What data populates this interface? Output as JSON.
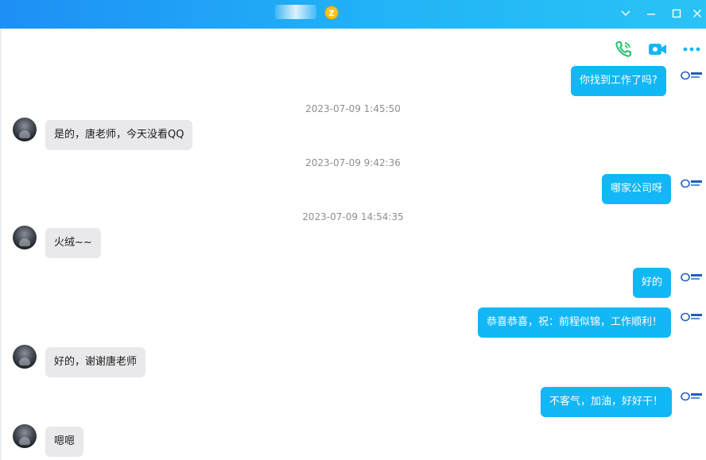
{
  "window": {
    "title_badge_icon": "level-badge-icon",
    "controls": [
      "chevron-down-icon",
      "minimize-icon",
      "maximize-icon",
      "close-icon"
    ]
  },
  "toolbar": {
    "icons": [
      "phone-call-icon",
      "video-call-icon",
      "more-icon"
    ]
  },
  "colors": {
    "titlebar_start": "#1e8ff5",
    "titlebar_end": "#2ac3f5",
    "outgoing_bubble": "#12b7f5",
    "incoming_bubble": "#e9e9eb",
    "phone_icon": "#22c36b",
    "video_icon": "#12b7f5"
  },
  "messages": [
    {
      "type": "outgoing",
      "text": "你找到工作了吗?"
    },
    {
      "type": "timestamp",
      "text": "2023-07-09 1:45:50"
    },
    {
      "type": "incoming",
      "text": "是的，唐老师，今天没看QQ"
    },
    {
      "type": "timestamp",
      "text": "2023-07-09 9:42:36"
    },
    {
      "type": "outgoing",
      "text": "哪家公司呀"
    },
    {
      "type": "timestamp",
      "text": "2023-07-09 14:54:35"
    },
    {
      "type": "incoming",
      "text": "火绒~~"
    },
    {
      "type": "outgoing",
      "text": "好的"
    },
    {
      "type": "outgoing",
      "text": "恭喜恭喜，祝：前程似锦，工作顺利！"
    },
    {
      "type": "incoming",
      "text": "好的，谢谢唐老师"
    },
    {
      "type": "outgoing",
      "text": "不客气，加油，好好干！"
    },
    {
      "type": "incoming",
      "text": "嗯嗯"
    }
  ]
}
